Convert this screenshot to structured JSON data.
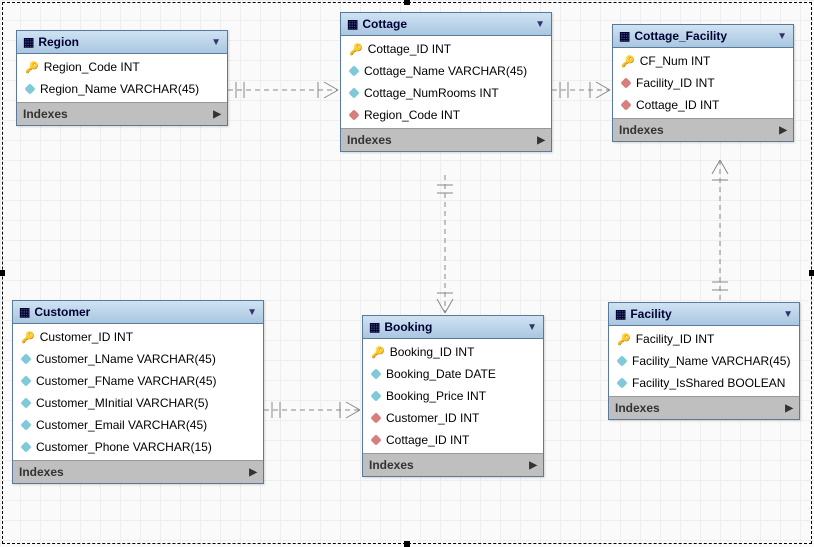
{
  "indexes_label": "Indexes",
  "tables": {
    "region": {
      "title": "Region",
      "cols": [
        {
          "name": "Region_Code INT",
          "type": "pk"
        },
        {
          "name": "Region_Name VARCHAR(45)",
          "type": "reg"
        }
      ]
    },
    "cottage": {
      "title": "Cottage",
      "cols": [
        {
          "name": "Cottage_ID INT",
          "type": "pk"
        },
        {
          "name": "Cottage_Name VARCHAR(45)",
          "type": "reg"
        },
        {
          "name": "Cottage_NumRooms INT",
          "type": "reg"
        },
        {
          "name": "Region_Code INT",
          "type": "fk"
        }
      ]
    },
    "cottage_facility": {
      "title": "Cottage_Facility",
      "cols": [
        {
          "name": "CF_Num INT",
          "type": "pk"
        },
        {
          "name": "Facility_ID INT",
          "type": "fk"
        },
        {
          "name": "Cottage_ID INT",
          "type": "fk"
        }
      ]
    },
    "customer": {
      "title": "Customer",
      "cols": [
        {
          "name": "Customer_ID INT",
          "type": "pk"
        },
        {
          "name": "Customer_LName VARCHAR(45)",
          "type": "reg"
        },
        {
          "name": "Customer_FName VARCHAR(45)",
          "type": "reg"
        },
        {
          "name": "Customer_MInitial VARCHAR(5)",
          "type": "reg"
        },
        {
          "name": "Customer_Email VARCHAR(45)",
          "type": "reg"
        },
        {
          "name": "Customer_Phone VARCHAR(15)",
          "type": "reg"
        }
      ]
    },
    "booking": {
      "title": "Booking",
      "cols": [
        {
          "name": "Booking_ID INT",
          "type": "pk"
        },
        {
          "name": "Booking_Date DATE",
          "type": "reg"
        },
        {
          "name": "Booking_Price INT",
          "type": "reg"
        },
        {
          "name": "Customer_ID INT",
          "type": "fk"
        },
        {
          "name": "Cottage_ID INT",
          "type": "fk"
        }
      ]
    },
    "facility": {
      "title": "Facility",
      "cols": [
        {
          "name": "Facility_ID INT",
          "type": "pk"
        },
        {
          "name": "Facility_Name VARCHAR(45)",
          "type": "reg"
        },
        {
          "name": "Facility_IsShared BOOLEAN",
          "type": "reg"
        }
      ]
    }
  }
}
